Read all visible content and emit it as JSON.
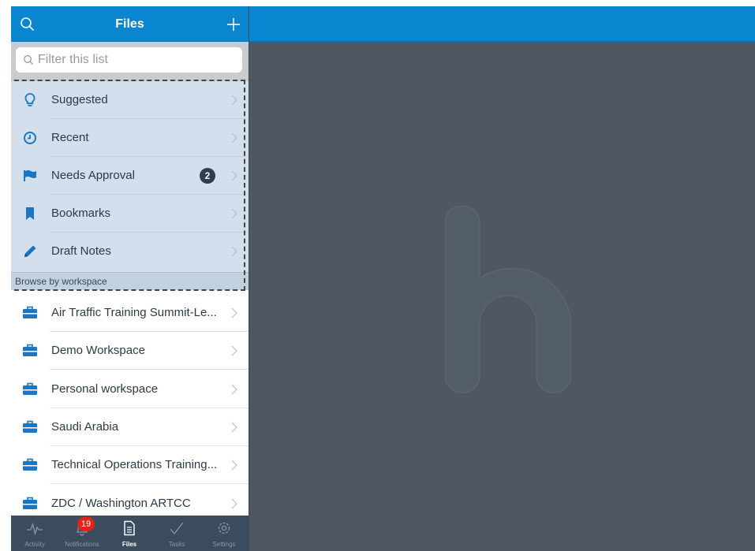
{
  "header": {
    "title": "Files",
    "search_icon": "search-icon",
    "add_icon": "plus-icon"
  },
  "filter": {
    "placeholder": "Filter this list",
    "value": ""
  },
  "quick_links": [
    {
      "label": "Suggested",
      "icon": "lightbulb-icon"
    },
    {
      "label": "Recent",
      "icon": "clock-icon"
    },
    {
      "label": "Needs Approval",
      "icon": "flag-icon",
      "badge": "2"
    },
    {
      "label": "Bookmarks",
      "icon": "bookmark-icon"
    },
    {
      "label": "Draft Notes",
      "icon": "pencil-icon"
    }
  ],
  "section_header": "Browse by workspace",
  "workspaces": [
    {
      "label": "Air Traffic Training Summit-Le...",
      "icon": "briefcase-icon"
    },
    {
      "label": "Demo Workspace",
      "icon": "briefcase-icon"
    },
    {
      "label": "Personal workspace",
      "icon": "briefcase-icon"
    },
    {
      "label": "Saudi Arabia",
      "icon": "briefcase-icon"
    },
    {
      "label": "Technical Operations Training...",
      "icon": "briefcase-icon"
    },
    {
      "label": "ZDC / Washington ARTCC",
      "icon": "briefcase-icon"
    }
  ],
  "tabbar": {
    "tabs": [
      {
        "label": "Activity",
        "icon": "activity-icon"
      },
      {
        "label": "Notifications",
        "icon": "bell-icon",
        "badge": "19"
      },
      {
        "label": "Files",
        "icon": "document-icon",
        "active": true
      },
      {
        "label": "Tasks",
        "icon": "checkmark-icon"
      },
      {
        "label": "Settings",
        "icon": "gear-icon"
      }
    ]
  },
  "colors": {
    "brand_blue": "#0a86d1",
    "main_bg": "#4f5860",
    "quick_bg": "#d3dfec",
    "tabbar_bg": "#3b4c5e",
    "badge_red": "#e2231a",
    "icon_blue": "#1a76c0"
  },
  "main": {
    "logo": "h-logo"
  }
}
